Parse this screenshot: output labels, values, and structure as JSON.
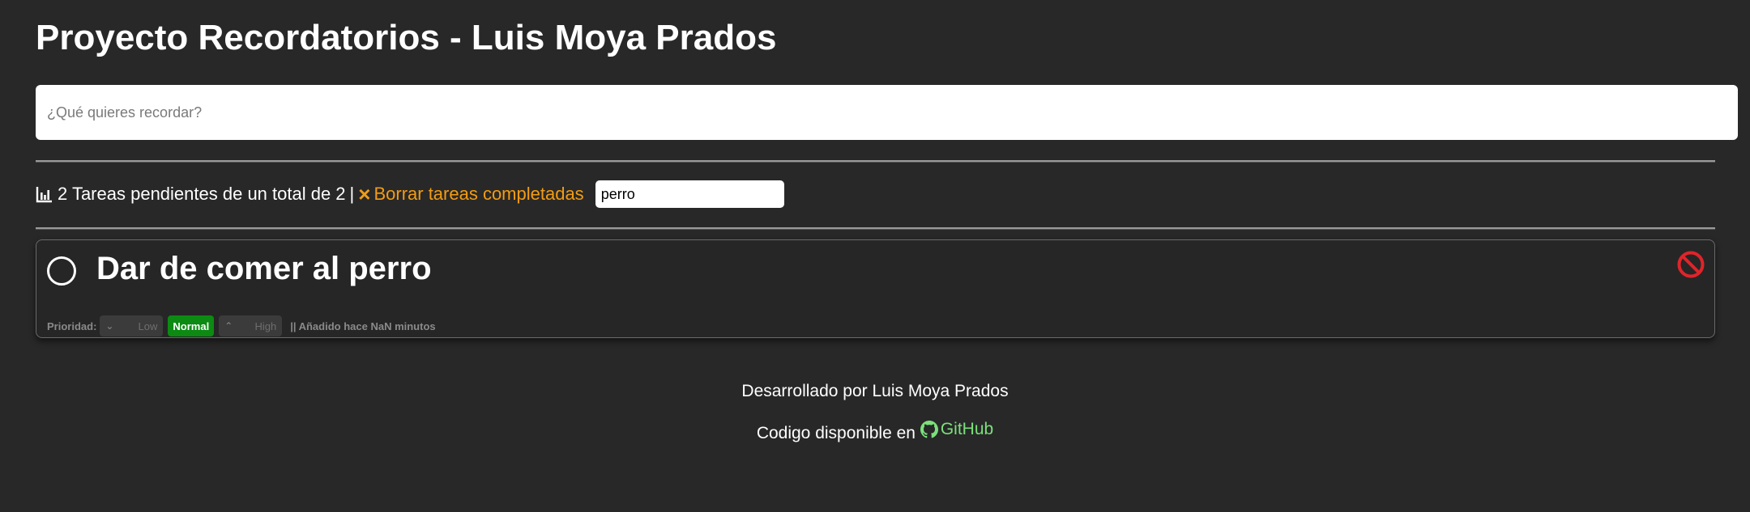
{
  "header": {
    "title": "Proyecto Recordatorios - Luis Moya Prados"
  },
  "new_task": {
    "placeholder": "¿Qué quieres recordar?",
    "value": ""
  },
  "summary": {
    "text": "2 Tareas pendientes de un total de 2",
    "separator": "|",
    "clear_icon": "×",
    "clear_label": "Borrar tareas completadas",
    "filter_value": "perro"
  },
  "tasks": [
    {
      "title": "Dar de comer al perro",
      "completed": false,
      "priority_label": "Prioridad:",
      "priority_low": "Low",
      "priority_normal": "Normal",
      "priority_high": "High",
      "selected_priority": "Normal",
      "added": "|| Añadido hace NaN minutos"
    }
  ],
  "footer": {
    "developed_by": "Desarrollado por Luis Moya Prados",
    "code_text": "Codigo disponible en",
    "github_label": "GitHub"
  },
  "colors": {
    "background": "#282828",
    "accent_orange": "#f39c12",
    "priority_selected": "#0c8a12",
    "delete_red": "#e0242a",
    "link_green": "#7be07b"
  },
  "icons": {
    "summary": "bar-chart-icon",
    "clear": "x-icon",
    "delete": "prohibited-icon",
    "github": "github-icon"
  }
}
